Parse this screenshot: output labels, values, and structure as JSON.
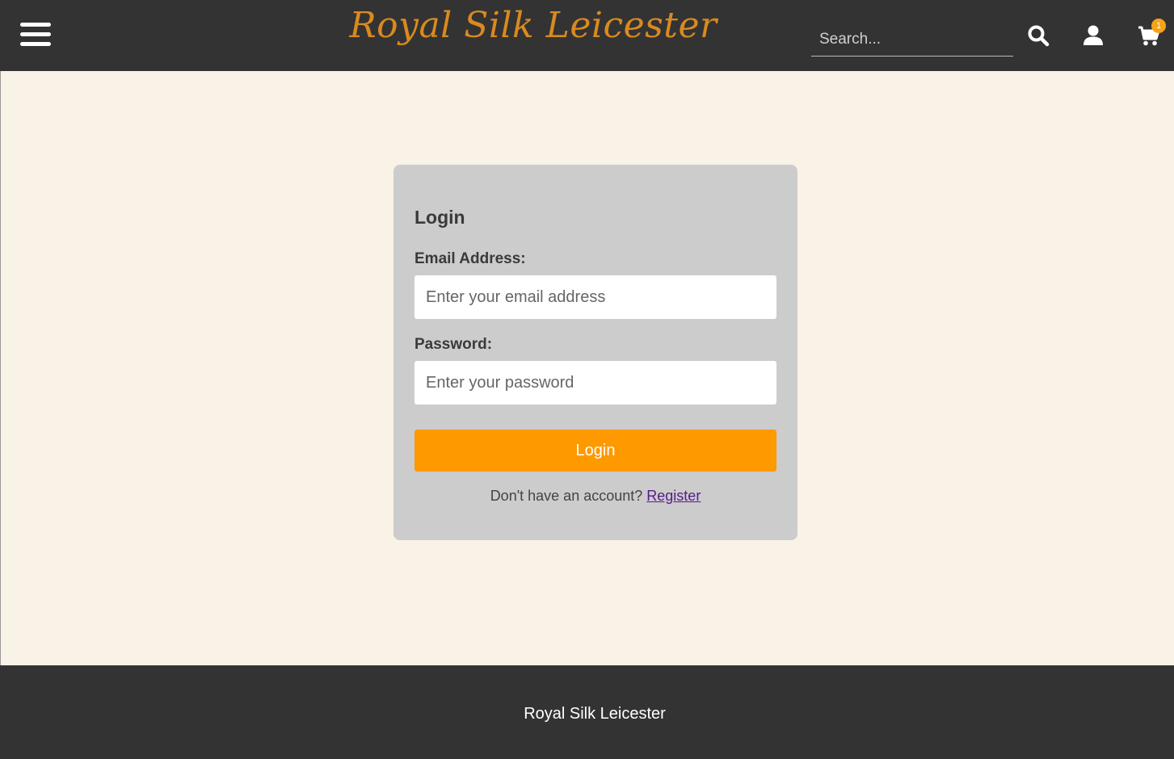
{
  "header": {
    "logo_text": "Royal Silk Leicester",
    "search_placeholder": "Search...",
    "cart_count": "1",
    "icons": [
      "menu-icon",
      "search-icon",
      "user-icon",
      "cart-icon"
    ]
  },
  "login": {
    "title": "Login",
    "email_label": "Email Address:",
    "email_placeholder": "Enter your email address",
    "email_value": "",
    "password_label": "Password:",
    "password_placeholder": "Enter your password",
    "password_value": "",
    "button_label": "Login",
    "register_prompt": "Don't have an account?",
    "register_link": "Register"
  },
  "footer": {
    "text": "Royal Silk Leicester"
  },
  "colors": {
    "header_bg": "#333333",
    "page_bg": "#f9f2e6",
    "card_bg": "#cccccc",
    "accent": "#ff9900",
    "logo": "#d98a1f",
    "link": "#551a8b"
  }
}
